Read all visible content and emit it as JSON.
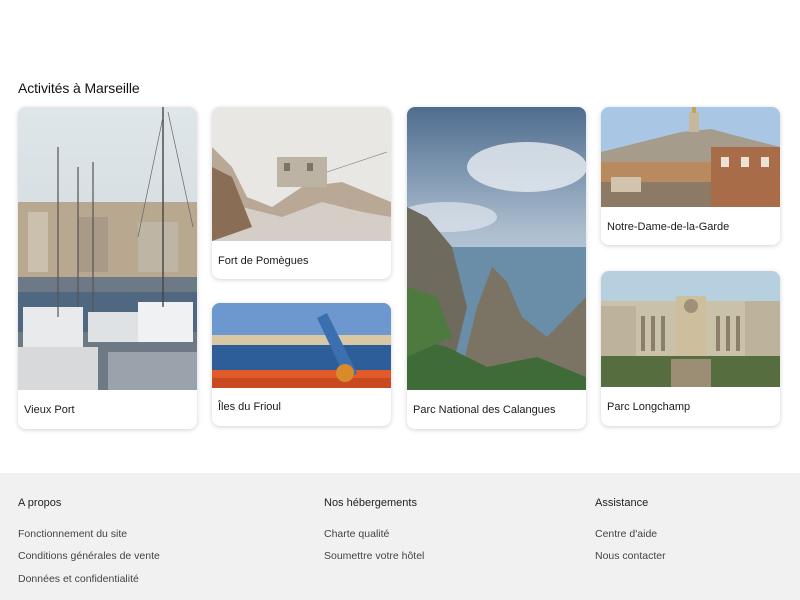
{
  "section": {
    "title": "Activités à Marseille"
  },
  "cards": [
    {
      "label": "Vieux Port"
    },
    {
      "label": "Fort de Pomègues"
    },
    {
      "label": "Îles du Frioul"
    },
    {
      "label": "Parc National des Calangues"
    },
    {
      "label": "Notre-Dame-de-la-Garde"
    },
    {
      "label": "Parc Longchamp"
    }
  ],
  "footer": {
    "columns": [
      {
        "title": "A propos",
        "links": [
          "Fonctionnement du site",
          "Conditions générales de vente",
          "Données et confidentialité"
        ]
      },
      {
        "title": "Nos hébergements",
        "links": [
          "Charte qualité",
          "Soumettre votre hôtel"
        ]
      },
      {
        "title": "Assistance",
        "links": [
          "Centre d'aide",
          "Nous contacter"
        ]
      }
    ]
  }
}
